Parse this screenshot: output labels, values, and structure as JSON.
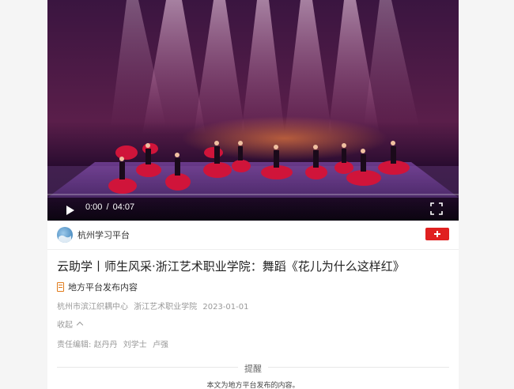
{
  "video": {
    "current_time": "0:00",
    "separator": "/",
    "duration": "04:07"
  },
  "source": {
    "name": "杭州学习平台"
  },
  "article": {
    "title": "云助学丨师生风采·浙江艺术职业学院：舞蹈《花儿为什么这样红》",
    "tag": "地方平台发布内容",
    "meta": [
      "杭州市滨江织耦中心",
      "浙江艺术职业学院",
      "2023-01-01"
    ],
    "collapse_label": "收起",
    "editors_label": "责任编辑:",
    "editors": [
      "赵丹丹",
      "刘学士",
      "卢强"
    ]
  },
  "notice": {
    "title": "提醒",
    "text": "本文为地方平台发布的内容。"
  },
  "colors": {
    "accent_red": "#e02020",
    "tag_orange": "#e07b1a"
  },
  "icons": {
    "play": "play-icon",
    "fullscreen": "fullscreen-icon",
    "follow": "plus-icon",
    "tag": "document-icon",
    "collapse": "chevron-up-icon"
  }
}
